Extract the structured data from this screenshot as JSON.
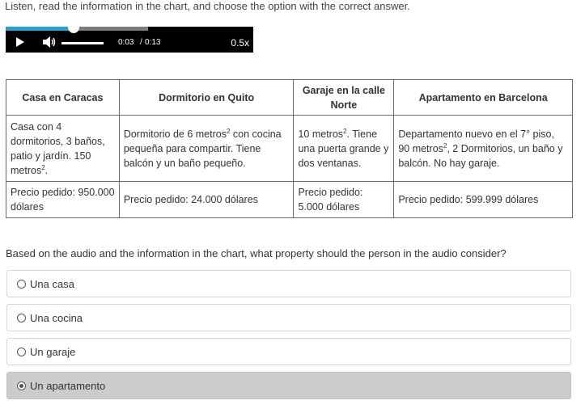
{
  "instructions": "Listen, read the information in the chart, and choose the option with the correct answer.",
  "audio": {
    "current_time": "0:03",
    "separator": "/",
    "duration": "0:13",
    "speed": "0.5x",
    "progress_fraction": 0.23,
    "volume_fraction": 1.0
  },
  "table": {
    "headers": [
      "Casa en Caracas",
      "Dormitorio en Quito",
      "Garaje en la calle Norte",
      "Apartamento en Barcelona"
    ],
    "descriptions": [
      {
        "before": "Casa con 4 dormitorios, 3 baños, patio y jardín. 150 metros",
        "sup": "2",
        "after": "."
      },
      {
        "before": "Dormitorio de 6 metros",
        "sup": "2",
        "after": " con cocina pequeña para compartir. Tiene balcón y un baño pequeño."
      },
      {
        "before": "10 metros",
        "sup": "2",
        "after": ". Tiene una puerta grande y dos ventanas."
      },
      {
        "before": "Departamento nuevo en el 7° piso, 90 metros",
        "sup": "2",
        "after": ", 2 Dormitorios, un baño y balcón. No hay garaje."
      }
    ],
    "prices": [
      "Precio pedido: 950.000 dólares",
      "Precio pedido: 24.000 dólares",
      "Precio pedido: 5.000 dólares",
      "Precio pedido: 599.999 dólares"
    ]
  },
  "question": "Based on the audio and the information in the chart, what property should the person in the audio consider?",
  "options": [
    {
      "label": "Una casa",
      "selected": false
    },
    {
      "label": "Una cocina",
      "selected": false
    },
    {
      "label": "Un garaje",
      "selected": false
    },
    {
      "label": "Un apartamento",
      "selected": true
    }
  ]
}
